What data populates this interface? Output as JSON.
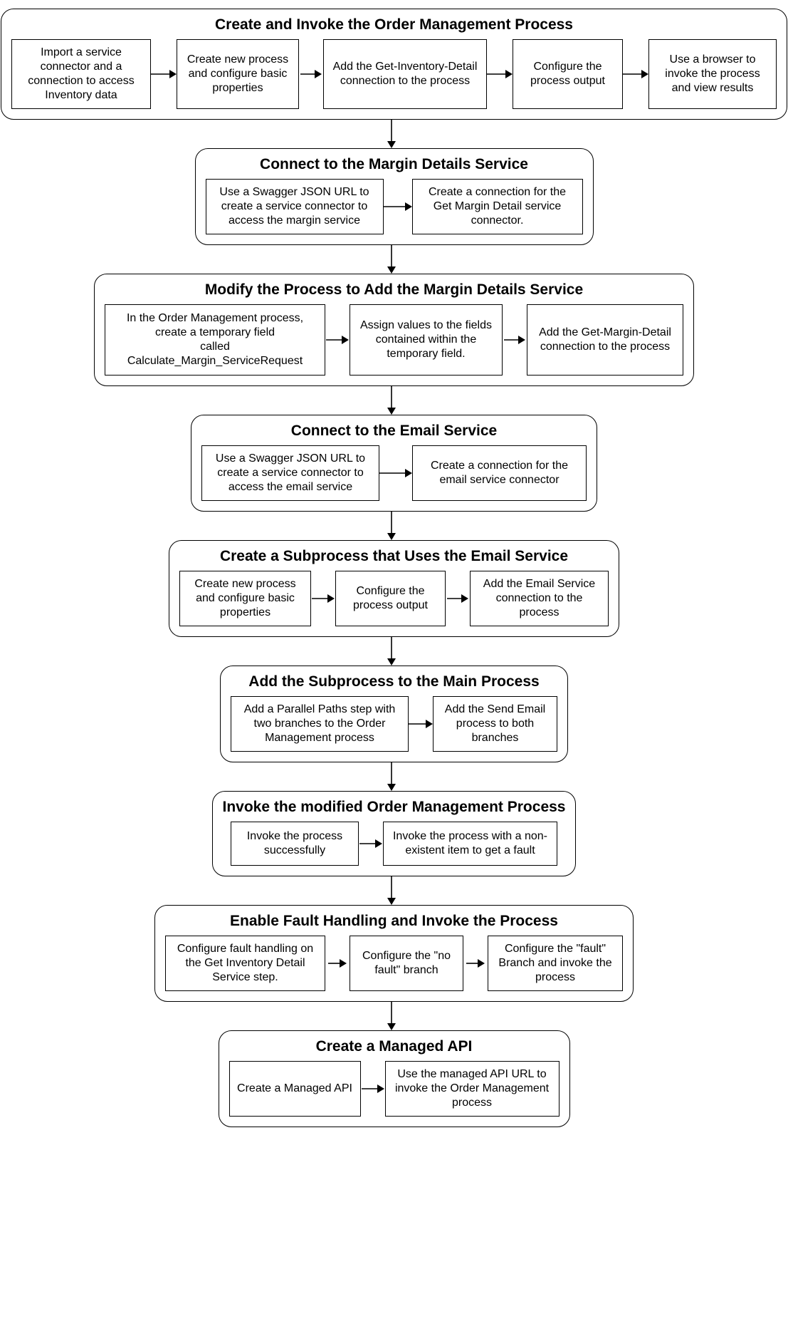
{
  "stages": [
    {
      "title": "Create and Invoke the Order Management Process",
      "steps": [
        "Import a service connector and a connection to access Inventory data",
        "Create new process and configure basic properties",
        "Add the Get-Inventory-Detail connection to the process",
        "Configure the process output",
        "Use a browser to invoke the process and view results"
      ]
    },
    {
      "title": "Connect to the Margin Details Service",
      "steps": [
        "Use a Swagger JSON URL to create a service connector to access the margin service",
        "Create a connection for the Get Margin Detail service connector."
      ]
    },
    {
      "title": "Modify the Process to Add the Margin Details Service",
      "steps": [
        "In the Order Management process, create a temporary field\ncalled Calculate_Margin_ServiceRequest",
        "Assign values to the fields contained within the temporary field.",
        "Add the Get-Margin-Detail connection to the process"
      ]
    },
    {
      "title": "Connect to the Email Service",
      "steps": [
        "Use a Swagger JSON URL to create a service connector to access the email service",
        "Create a connection for the email service connector"
      ]
    },
    {
      "title": "Create a Subprocess that Uses the Email Service",
      "steps": [
        "Create new process and configure basic properties",
        "Configure the process output",
        "Add the Email Service connection to the process"
      ]
    },
    {
      "title": "Add the Subprocess to the Main Process",
      "steps": [
        "Add a Parallel Paths step with two branches to the Order Management process",
        "Add the Send Email process to both branches"
      ]
    },
    {
      "title": "Invoke the modified Order Management Process",
      "steps": [
        "Invoke the process successfully",
        "Invoke the process with a non-existent item to get a fault"
      ]
    },
    {
      "title": "Enable Fault Handling and Invoke the Process",
      "steps": [
        "Configure fault handling on the Get Inventory Detail Service step.",
        "Configure the \"no fault\" branch",
        "Configure the \"fault\" Branch and invoke the process"
      ]
    },
    {
      "title": "Create a Managed API",
      "steps": [
        "Create a Managed API",
        "Use the managed API URL to invoke the Order Management process"
      ]
    }
  ],
  "layout": {
    "stepWidths": [
      [
        196,
        172,
        230,
        155,
        180
      ],
      [
        250,
        240
      ],
      [
        310,
        215,
        220
      ],
      [
        250,
        245
      ],
      [
        185,
        155,
        195
      ],
      [
        250,
        175
      ],
      [
        180,
        245
      ],
      [
        225,
        160,
        190
      ],
      [
        185,
        245
      ]
    ],
    "stepHeights": [
      92,
      78,
      100,
      78,
      78,
      78,
      62,
      78,
      78
    ],
    "hArrowWidths": [
      [
        36,
        30,
        36,
        36
      ],
      [
        40
      ],
      [
        32,
        30
      ],
      [
        46
      ],
      [
        32,
        30
      ],
      [
        34
      ],
      [
        32
      ],
      [
        26,
        26
      ],
      [
        32
      ]
    ],
    "vArrowHeight": 40
  }
}
